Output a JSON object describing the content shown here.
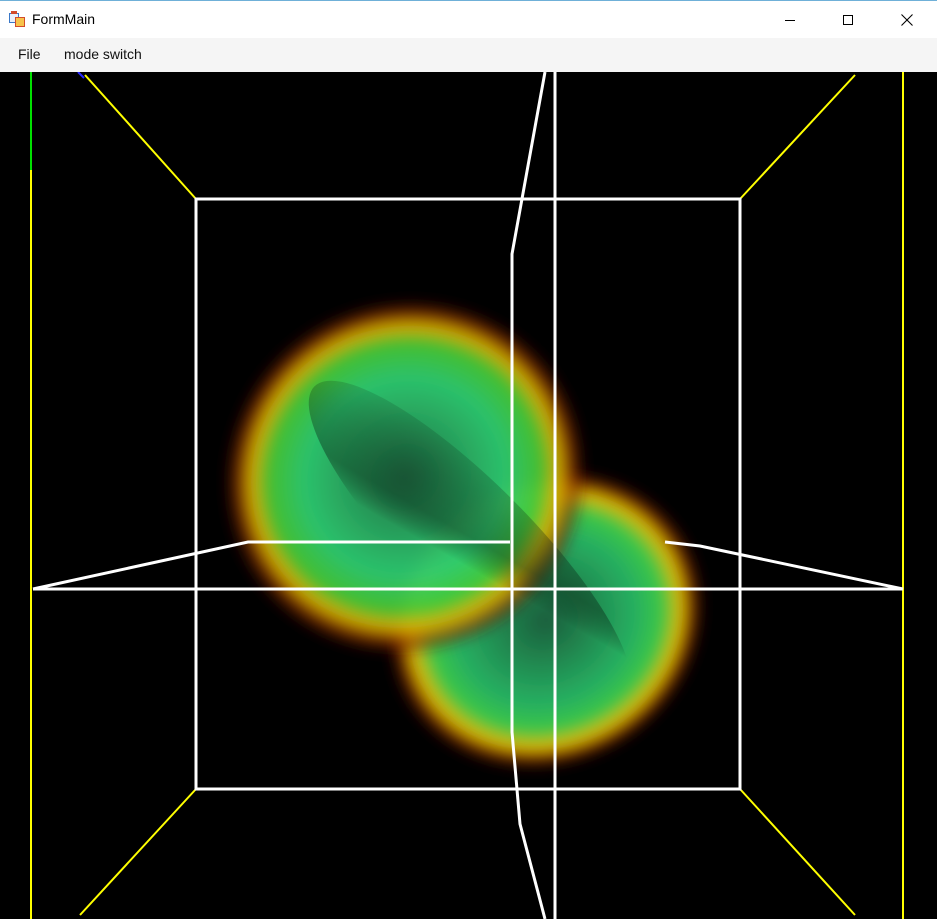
{
  "window": {
    "title": "FormMain",
    "icon": "app-form-icon",
    "controls": {
      "minimize": "minimize-icon",
      "maximize": "maximize-icon",
      "close": "close-icon"
    }
  },
  "menu": {
    "items": [
      {
        "label": "File"
      },
      {
        "label": "mode switch"
      }
    ]
  },
  "viewport": {
    "background": "#000000",
    "frame_color": "#ffffff",
    "outer_box_color": "#ffff00",
    "axis_y_color": "#00ff00",
    "axis_z_color": "#0000ff",
    "volume_colors": [
      "#2ecc71",
      "#ffd700",
      "#b22222"
    ]
  }
}
